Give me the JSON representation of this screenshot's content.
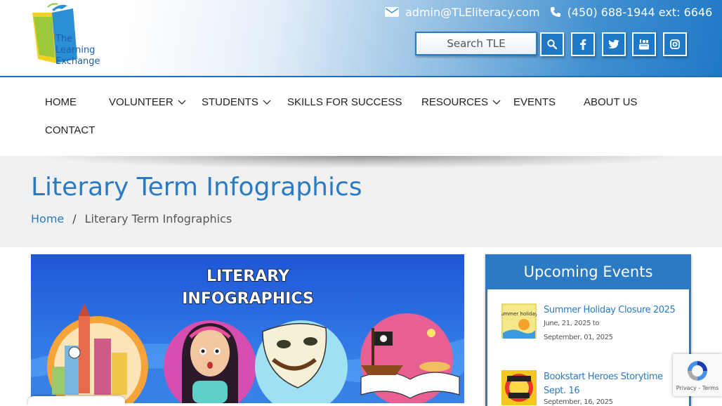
{
  "header": {
    "logo_lines": [
      "The",
      "Learning",
      "Exchange"
    ],
    "email": "admin@TLEliteracy.com",
    "phone": "(450) 688-1944 ext: 6646",
    "search_placeholder": "Search TLE",
    "social_icons": [
      "search-icon",
      "facebook-icon",
      "twitter-icon",
      "youtube-icon",
      "instagram-icon"
    ],
    "colors": {
      "brand_blue": "#2a7bc4",
      "header_blue": "#1f78c6"
    }
  },
  "nav": {
    "items": [
      {
        "label": "HOME",
        "has_dropdown": false
      },
      {
        "label": "VOLUNTEER",
        "has_dropdown": true
      },
      {
        "label": "STUDENTS",
        "has_dropdown": true
      },
      {
        "label": "SKILLS FOR SUCCESS",
        "has_dropdown": false
      },
      {
        "label": "RESOURCES",
        "has_dropdown": true
      },
      {
        "label": "EVENTS",
        "has_dropdown": false
      },
      {
        "label": "ABOUT US",
        "has_dropdown": false
      },
      {
        "label": "CONTACT",
        "has_dropdown": false
      }
    ]
  },
  "page": {
    "title": "Literary Term Infographics",
    "breadcrumb": {
      "home": "Home",
      "separator": "/",
      "current": "Literary Term Infographics"
    }
  },
  "hero": {
    "line1": "LITERARY",
    "line2": "INFOGRAPHICS"
  },
  "events": {
    "heading": "Upcoming Events",
    "items": [
      {
        "title": "Summer Holiday Closure 2025",
        "date_line1": "June, 21, 2025 to",
        "date_line2": "September, 01, 2025",
        "thumb_text": "Summer holidays"
      },
      {
        "title": "Bookstart Heroes Storytime Sept. 16",
        "date_line1": "September, 16, 2025",
        "date_line2": "",
        "thumb_text": ""
      }
    ]
  },
  "recaptcha": {
    "label": "Privacy - Terms"
  }
}
